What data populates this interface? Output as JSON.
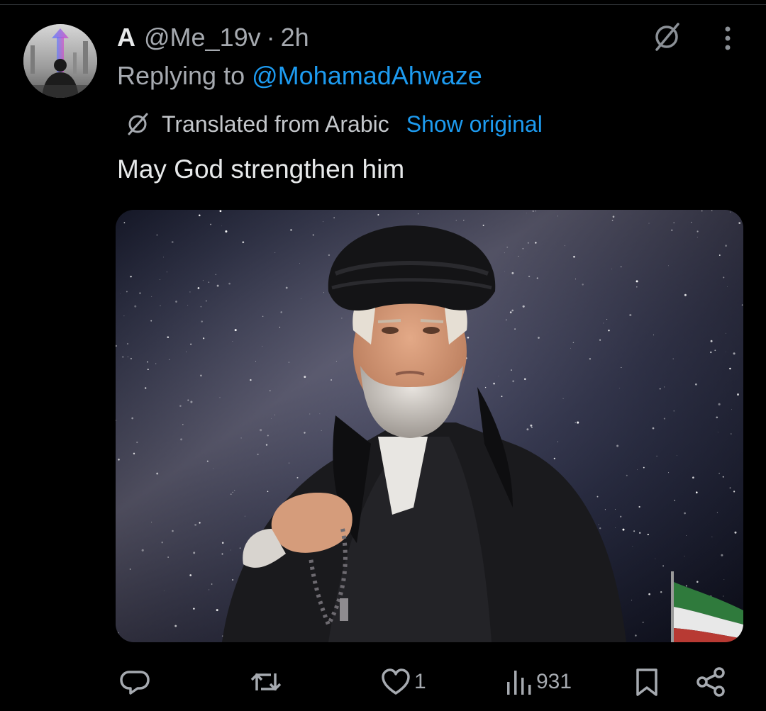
{
  "author": {
    "display_name": "A",
    "handle": "@Me_19v",
    "separator": "·",
    "time": "2h"
  },
  "reply": {
    "prefix": "Replying to",
    "handle": "@MohamadAhwaze"
  },
  "translation": {
    "label": "Translated from Arabic",
    "show_original": "Show original"
  },
  "tweet": {
    "text": "May God strengthen him"
  },
  "actions": {
    "reply_count": "",
    "retweet_count": "",
    "like_count": "1",
    "views_count": "931"
  },
  "icons": {
    "avatar": "avatar-image",
    "grok": "grok-icon",
    "more": "more-vertical-icon",
    "reply": "reply-icon",
    "retweet": "retweet-icon",
    "like": "heart-icon",
    "views": "views-chart-icon",
    "bookmark": "bookmark-icon",
    "share": "share-icon"
  },
  "colors": {
    "background": "#000000",
    "primary_text": "#e7e9ea",
    "secondary_text": "#a6aab0",
    "link": "#1d9bf0"
  }
}
